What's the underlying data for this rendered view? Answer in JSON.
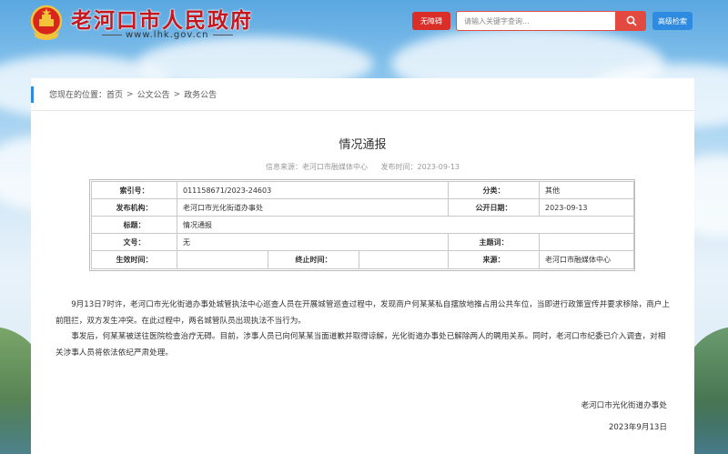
{
  "header": {
    "site_title": "老河口市人民政府",
    "site_url": "www.lhk.gov.cn",
    "barrier_free_label": "无障碍",
    "search_placeholder": "请输入关键字查询...",
    "advanced_search_label": "高级检索",
    "colors": {
      "brand_red": "#c8161d",
      "accent_blue": "#2f8be0",
      "search_red": "#e3493f"
    }
  },
  "breadcrumb": {
    "prefix": "您现在的位置：",
    "items": [
      "首页",
      "公文公告",
      "政务公告"
    ],
    "separator": ">"
  },
  "article": {
    "title": "情况通报",
    "source_label": "信息来源：老河口市融媒体中心",
    "date_label": "发布时间：2023-09-13",
    "info_table": {
      "index_label": "索引号：",
      "index_value": "011158671/2023-24603",
      "category_label": "分类：",
      "category_value": "其他",
      "publisher_label": "发布机构：",
      "publisher_value": "老河口市光化街道办事处",
      "public_date_label": "公开日期：",
      "public_date_value": "2023-09-13",
      "title_label": "标题：",
      "title_value": "情况通报",
      "doc_no_label": "文号：",
      "doc_no_value": "无",
      "subject_label": "主题词：",
      "subject_value": "",
      "effective_label": "生效时间：",
      "effective_value": "",
      "expire_label": "终止时间：",
      "expire_value": "",
      "origin_label": "来源：",
      "origin_value": "老河口市融媒体中心"
    },
    "paragraphs": [
      "9月13日7时许，老河口市光化街道办事处城管执法中心巡查人员在开展城管巡查过程中，发现商户何某某私自摆放地推占用公共车位，当即进行政策宣传并要求移除，商户上前阻拦，双方发生冲突。在此过程中，两名城管队员出现执法不当行为。",
      "事发后，何某某被送往医院检查治疗无碍。目前，涉事人员已向何某某当面道歉并取得谅解，光化街道办事处已解除两人的聘用关系。同时，老河口市纪委已介入调查，对相关涉事人员将依法依纪严肃处理。"
    ],
    "signature_org": "老河口市光化街道办事处",
    "signature_date": "2023年9月13日"
  }
}
